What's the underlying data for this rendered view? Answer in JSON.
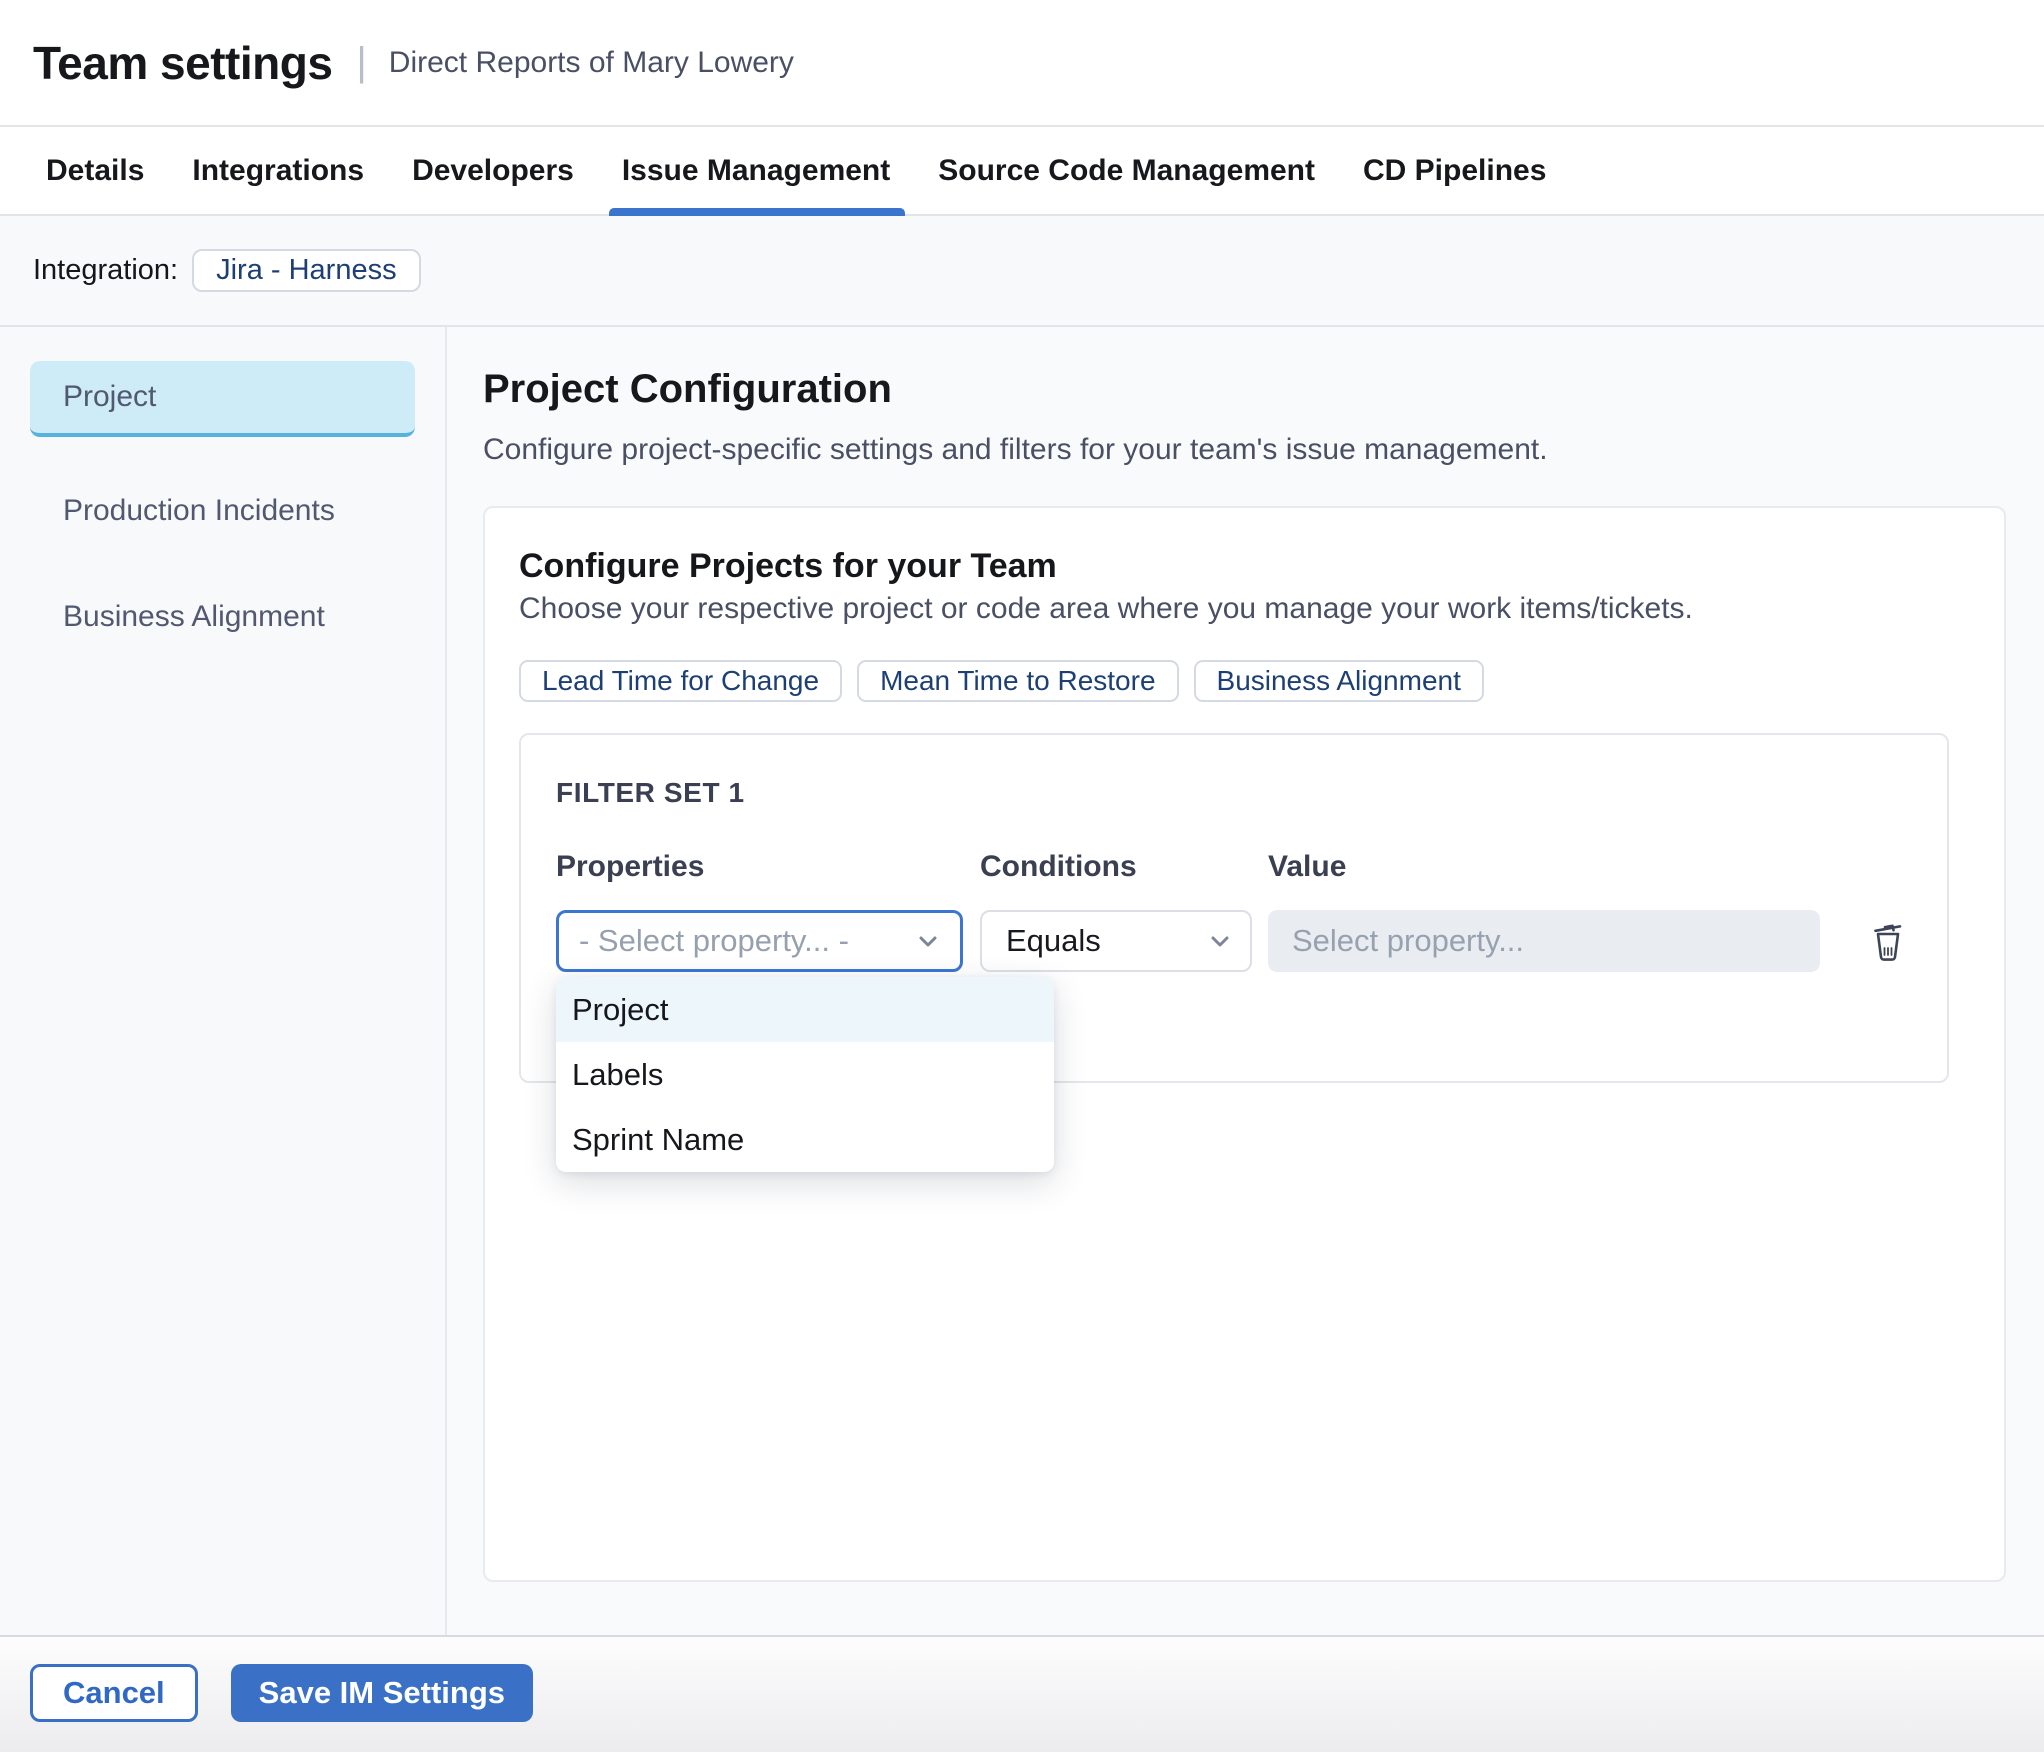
{
  "header": {
    "title": "Team settings",
    "separator": "|",
    "subtitle": "Direct Reports of Mary Lowery"
  },
  "tabs": {
    "items": [
      "Details",
      "Integrations",
      "Developers",
      "Issue Management",
      "Source Code Management",
      "CD Pipelines"
    ],
    "active": "Issue Management"
  },
  "integration": {
    "label": "Integration:",
    "chip": "Jira - Harness"
  },
  "sidebar": {
    "items": [
      "Project",
      "Production Incidents",
      "Business Alignment"
    ],
    "selected": "Project"
  },
  "main": {
    "title": "Project Configuration",
    "description": "Configure project-specific settings and filters for your team's issue management.",
    "card": {
      "title": "Configure Projects for your Team",
      "description": "Choose your respective project or code area where you manage your work items/tickets.",
      "metric_chips": [
        "Lead Time for Change",
        "Mean Time to Restore",
        "Business Alignment"
      ],
      "filter_set": {
        "title": "FILTER SET 1",
        "columns": [
          "Properties",
          "Conditions",
          "Value"
        ],
        "property_placeholder": "- Select property... -",
        "condition_value": "Equals",
        "value_placeholder": "Select property...",
        "dropdown_options": [
          "Project",
          "Labels",
          "Sprint Name"
        ],
        "highlighted_option": "Project",
        "icons": {
          "delete": "trash-icon",
          "select_chevron": "chevron-down-icon"
        }
      }
    }
  },
  "footer": {
    "cancel_label": "Cancel",
    "save_label": "Save IM Settings"
  },
  "colors": {
    "accent_blue": "#3a71c6",
    "focus_border": "#3b76d1",
    "tab_underline": "#3b74cc",
    "selected_nav_bg": "#cdecf8",
    "selected_nav_border": "#57b3de",
    "chip_text": "#1d3f73",
    "dropdown_highlight": "#edf6fb",
    "disabled_input_bg": "#e9edf1"
  }
}
